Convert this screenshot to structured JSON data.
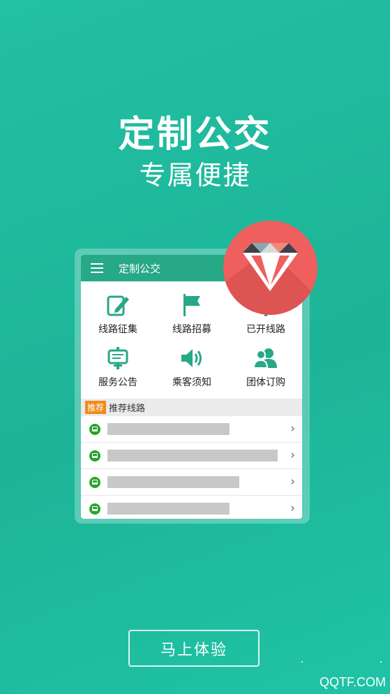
{
  "headline": {
    "title": "定制公交",
    "subtitle": "专属便捷"
  },
  "app": {
    "title": "定制公交",
    "menu": [
      {
        "label": "线路征集",
        "icon": "edit-icon"
      },
      {
        "label": "线路招募",
        "icon": "flag-icon"
      },
      {
        "label": "已开线路",
        "icon": "route-icon"
      },
      {
        "label": "服务公告",
        "icon": "notice-board-icon"
      },
      {
        "label": "乘客须知",
        "icon": "speaker-icon"
      },
      {
        "label": "团体订购",
        "icon": "group-icon"
      }
    ],
    "recommend": {
      "badge": "推荐",
      "label": "推荐线路"
    },
    "routes": [
      "",
      "",
      "",
      ""
    ]
  },
  "cta": {
    "label": "马上体验"
  },
  "watermark": "QQTF.COM",
  "colors": {
    "background": "#1fbb9f",
    "appbar": "#27a886",
    "badge": "#f08b1c",
    "diamond_circle": "#ee5f5d",
    "bus_icon": "#27a52c"
  }
}
